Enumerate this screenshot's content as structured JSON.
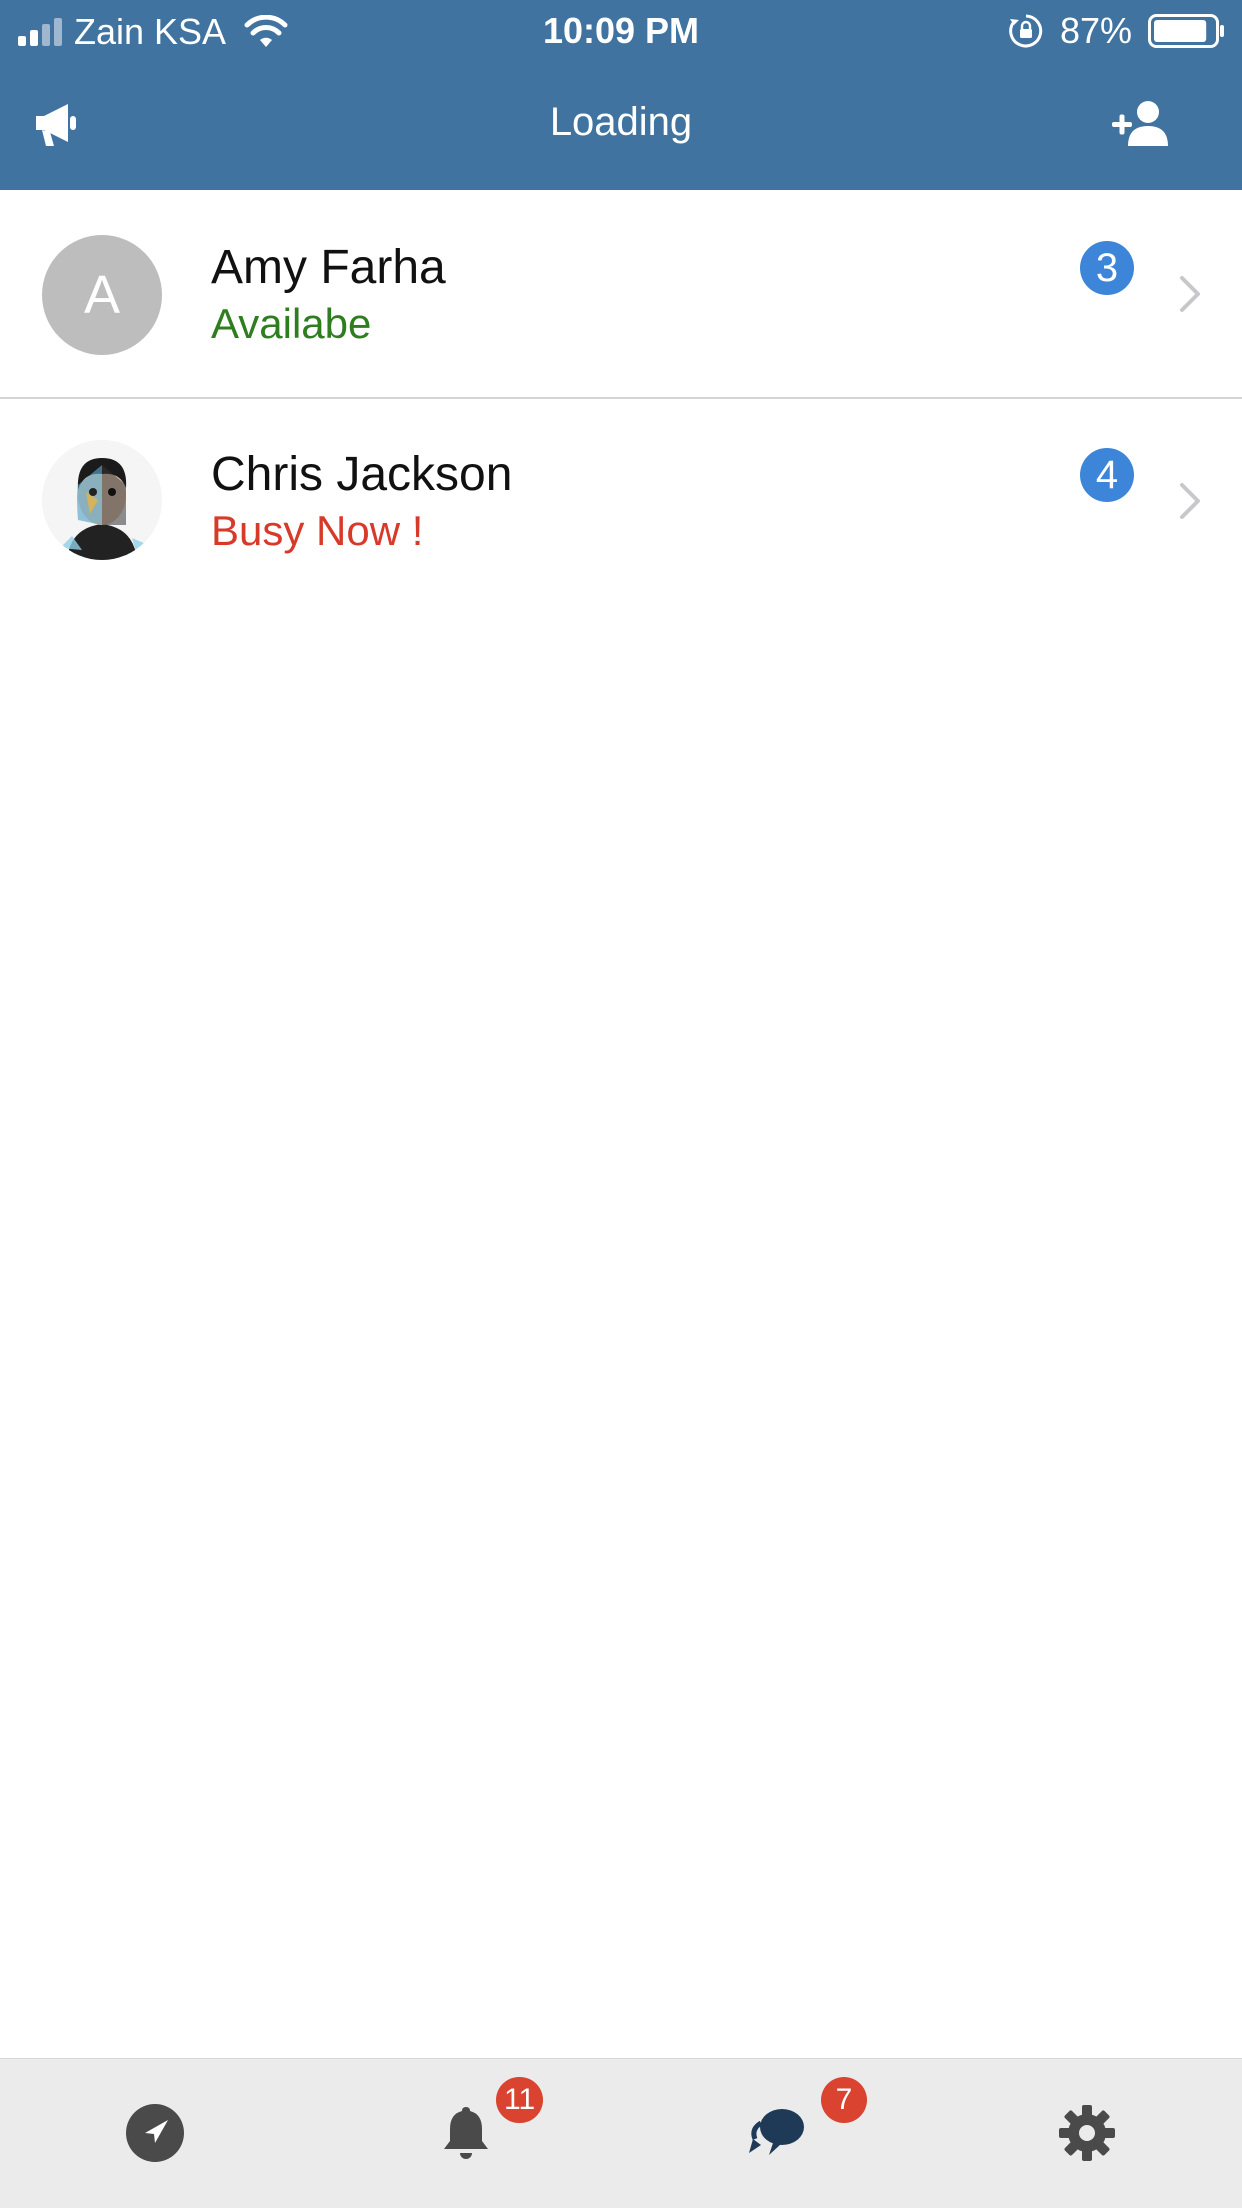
{
  "status_bar": {
    "carrier": "Zain KSA",
    "time": "10:09 PM",
    "battery_percent": "87%",
    "battery_level": 0.87,
    "icons": [
      "signal-icon",
      "wifi-icon",
      "rotation-lock-icon",
      "battery-icon"
    ]
  },
  "nav": {
    "title": "Loading",
    "left_icon": "megaphone-icon",
    "right_icon": "add-user-icon"
  },
  "contacts": [
    {
      "name": "Amy Farha",
      "status": "Availabe",
      "status_color": "#2e7d1f",
      "avatar_initial": "A",
      "unread": "3"
    },
    {
      "name": "Chris Jackson",
      "status": "Busy Now !",
      "status_color": "#d83a2a",
      "avatar_initial": "",
      "unread": "4"
    }
  ],
  "tab_bar": {
    "tabs": [
      {
        "icon": "location-arrow-icon",
        "badge": ""
      },
      {
        "icon": "bell-icon",
        "badge": "11"
      },
      {
        "icon": "chat-bubbles-icon",
        "badge": "7"
      },
      {
        "icon": "gear-icon",
        "badge": ""
      }
    ]
  },
  "colors": {
    "header": "#40739f",
    "badge_blue": "#3d85d9",
    "badge_red": "#d9432f",
    "tab_bar_bg": "#ebebeb"
  }
}
